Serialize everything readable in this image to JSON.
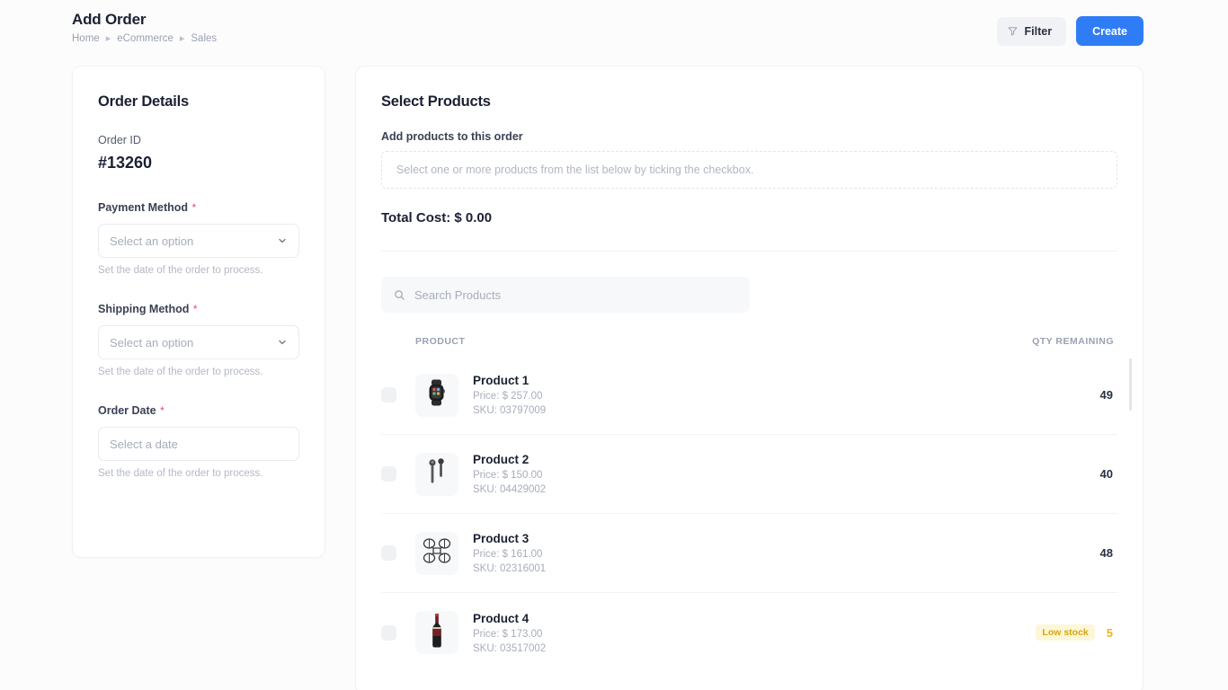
{
  "header": {
    "title": "Add Order",
    "breadcrumb": [
      "Home",
      "eCommerce",
      "Sales"
    ],
    "separator": "▸",
    "filter_label": "Filter",
    "create_label": "Create"
  },
  "colors": {
    "accent": "#2f7df6",
    "required": "#f0416c",
    "warning_text": "#d3a70f",
    "warning_bg": "#fdf6d8",
    "page_bg": "#fcfcfd",
    "card_bg": "#ffffff"
  },
  "order_details": {
    "title": "Order Details",
    "order_id_label": "Order ID",
    "order_id_value": "#13260",
    "fields": [
      {
        "label": "Payment Method",
        "required": "*",
        "value": "",
        "placeholder": "Select an option",
        "helper": "Set the date of the order to process."
      },
      {
        "label": "Shipping Method",
        "required": "*",
        "value": "",
        "placeholder": "Select an option",
        "helper": "Set the date of the order to process."
      },
      {
        "label": "Order Date",
        "required": "*",
        "value": "",
        "placeholder": "Select a date",
        "helper": "Set the date of the order to process."
      }
    ]
  },
  "select_products": {
    "title": "Select Products",
    "sub_label": "Add products to this order",
    "dropzone_text": "Select one or more products from the list below by ticking the checkbox.",
    "total_cost": "Total Cost: $ 0.00",
    "search_placeholder": "Search Products",
    "search_value": "",
    "columns": {
      "product": "PRODUCT",
      "qty": "QTY REMAINING"
    },
    "rows": [
      {
        "name": "Product 1",
        "price": "Price: $ 257.00",
        "sku": "SKU: 03797009",
        "qty": "49",
        "badge": "",
        "low": false,
        "checked": false,
        "icon": "smartwatch-icon"
      },
      {
        "name": "Product 2",
        "price": "Price: $ 150.00",
        "sku": "SKU: 04429002",
        "qty": "40",
        "badge": "",
        "low": false,
        "checked": false,
        "icon": "earbuds-icon"
      },
      {
        "name": "Product 3",
        "price": "Price: $ 161.00",
        "sku": "SKU: 02316001",
        "qty": "48",
        "badge": "",
        "low": false,
        "checked": false,
        "icon": "drone-icon"
      },
      {
        "name": "Product 4",
        "price": "Price: $ 173.00",
        "sku": "SKU: 03517002",
        "qty": "5",
        "badge": "Low stock",
        "low": true,
        "checked": false,
        "icon": "wine-bottle-icon"
      }
    ]
  }
}
